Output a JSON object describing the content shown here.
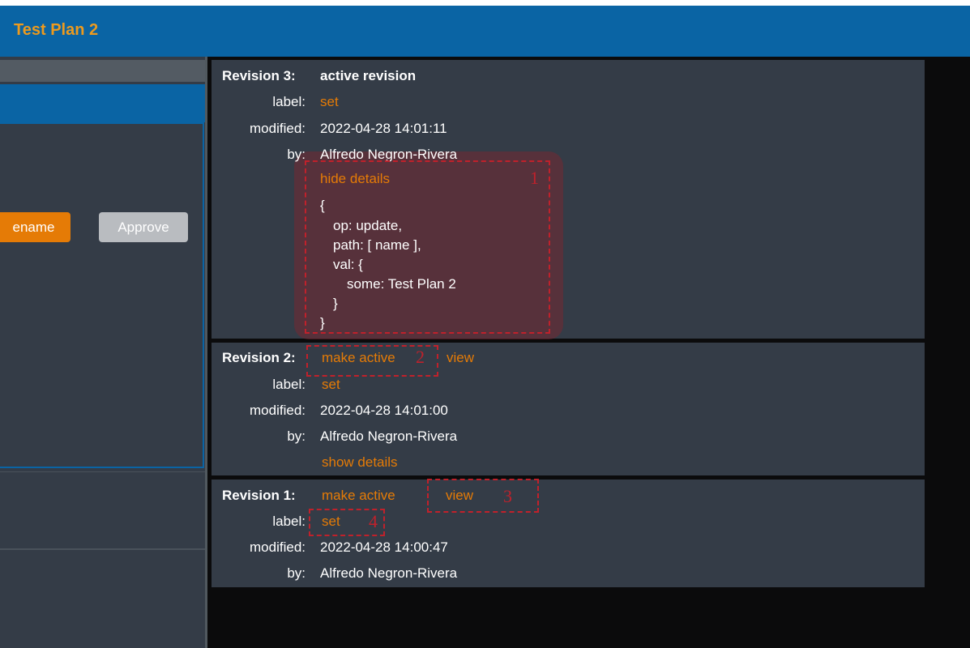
{
  "header": {
    "title": "Test Plan 2"
  },
  "left_panel": {
    "rename_button": "ename",
    "approve_button": "Approve"
  },
  "revisions": [
    {
      "header": "Revision 3:",
      "status": "active revision",
      "label_key": "label:",
      "label_link": "set",
      "modified_key": "modified:",
      "modified": "2022-04-28 14:01:11",
      "by_key": "by:",
      "by": "Alfredo Negron-Rivera",
      "details_link": "hide details",
      "details": [
        "{",
        "op: update,",
        "path: [ name ],",
        "val: {",
        "some: Test Plan 2",
        "}",
        "}"
      ]
    },
    {
      "header": "Revision 2:",
      "make_active": "make active",
      "view": "view",
      "label_key": "label:",
      "label_link": "set",
      "modified_key": "modified:",
      "modified": "2022-04-28 14:01:00",
      "by_key": "by:",
      "by": "Alfredo Negron-Rivera",
      "details_link": "show details"
    },
    {
      "header": "Revision 1:",
      "make_active": "make active",
      "view": "view",
      "label_key": "label:",
      "label_link": "set",
      "modified_key": "modified:",
      "modified": "2022-04-28 14:00:47",
      "by_key": "by:",
      "by": "Alfredo Negron-Rivera"
    }
  ],
  "annotations": [
    "1",
    "2",
    "3",
    "4"
  ],
  "colors": {
    "accent_orange": "#e57b06",
    "header_blue": "#0a64a4",
    "panel": "#343c47",
    "annotation_red": "#c0212b"
  }
}
